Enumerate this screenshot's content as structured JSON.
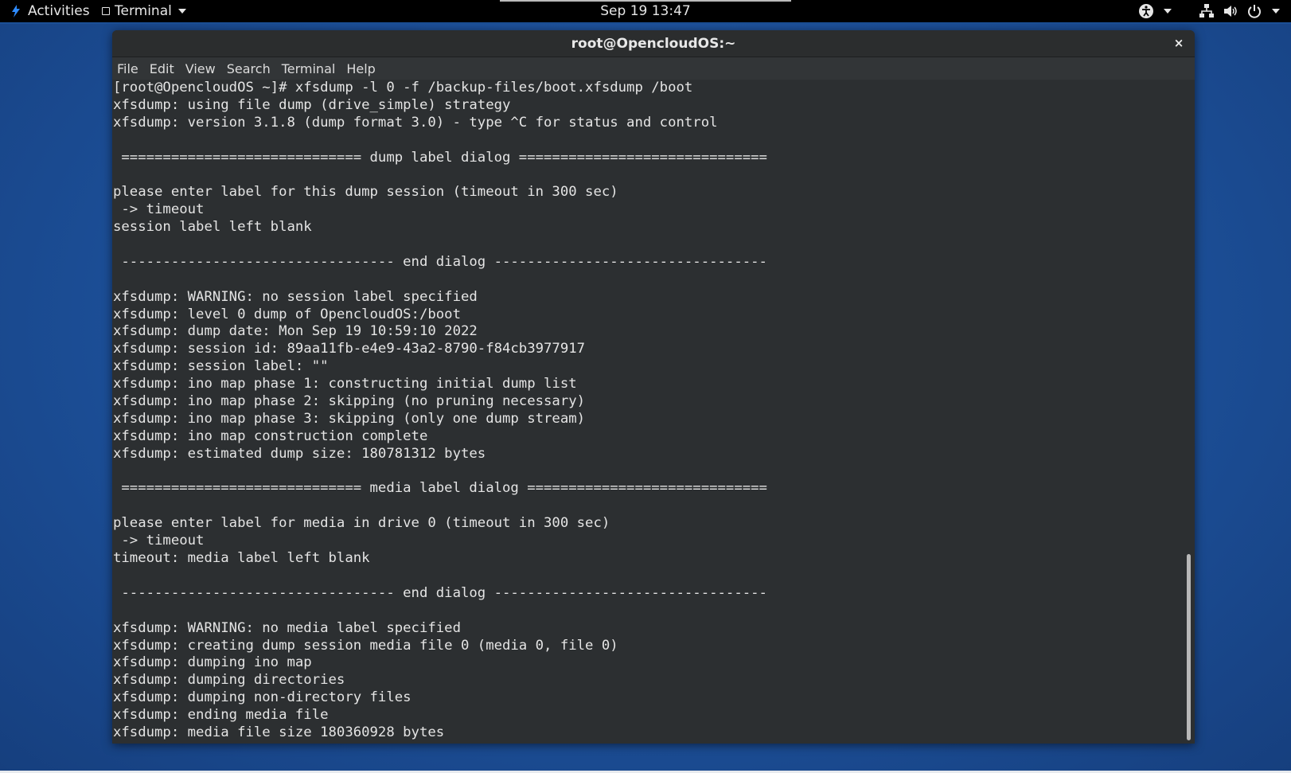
{
  "topbar": {
    "activities_label": "Activities",
    "app_menu_label": "Terminal",
    "clock": "Sep 19  13:47",
    "tray_icons": [
      "accessibility-icon",
      "network-icon",
      "volume-icon",
      "power-icon"
    ]
  },
  "window": {
    "title": "root@OpencloudOS:~",
    "close_glyph": "×",
    "menu": [
      "File",
      "Edit",
      "View",
      "Search",
      "Terminal",
      "Help"
    ]
  },
  "terminal": {
    "lines": [
      "[root@OpencloudOS ~]# xfsdump -l 0 -f /backup-files/boot.xfsdump /boot",
      "xfsdump: using file dump (drive_simple) strategy",
      "xfsdump: version 3.1.8 (dump format 3.0) - type ^C for status and control",
      "",
      " ============================= dump label dialog ==============================",
      "",
      "please enter label for this dump session (timeout in 300 sec)",
      " -> timeout",
      "session label left blank",
      "",
      " --------------------------------- end dialog ---------------------------------",
      "",
      "xfsdump: WARNING: no session label specified",
      "xfsdump: level 0 dump of OpencloudOS:/boot",
      "xfsdump: dump date: Mon Sep 19 10:59:10 2022",
      "xfsdump: session id: 89aa11fb-e4e9-43a2-8790-f84cb3977917",
      "xfsdump: session label: \"\"",
      "xfsdump: ino map phase 1: constructing initial dump list",
      "xfsdump: ino map phase 2: skipping (no pruning necessary)",
      "xfsdump: ino map phase 3: skipping (only one dump stream)",
      "xfsdump: ino map construction complete",
      "xfsdump: estimated dump size: 180781312 bytes",
      "",
      " ============================= media label dialog =============================",
      "",
      "please enter label for media in drive 0 (timeout in 300 sec)",
      " -> timeout",
      "timeout: media label left blank",
      "",
      " --------------------------------- end dialog ---------------------------------",
      "",
      "xfsdump: WARNING: no media label specified",
      "xfsdump: creating dump session media file 0 (media 0, file 0)",
      "xfsdump: dumping ino map",
      "xfsdump: dumping directories",
      "xfsdump: dumping non-directory files",
      "xfsdump: ending media file",
      "xfsdump: media file size 180360928 bytes"
    ]
  }
}
